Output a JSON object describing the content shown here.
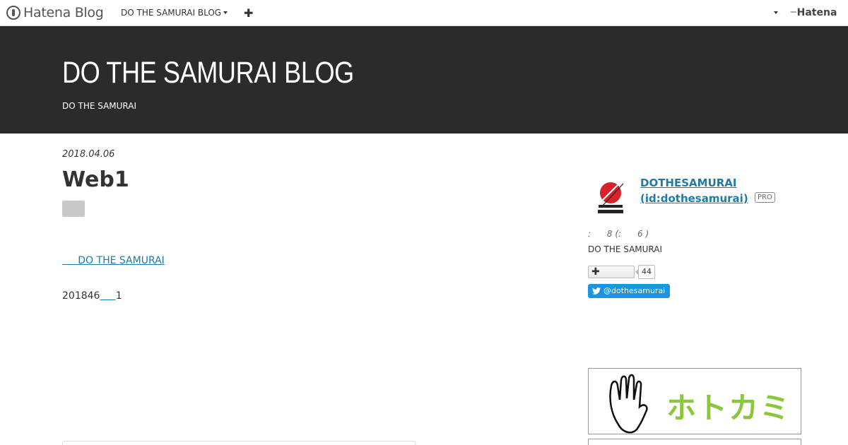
{
  "topbar": {
    "logo_text": "Hatena Blog",
    "blog_menu_label": "DO THE SAMURAI BLOG",
    "plus_label": "✚",
    "hatena_text": "Hatena"
  },
  "header": {
    "title": "DO THE SAMURAI BLOG",
    "description": "DO THE SAMURAI"
  },
  "entry": {
    "date": "2018.04.06",
    "title": "Web1",
    "link_text": "DO THE SAMURAI",
    "link_prefix": "     ",
    "body_prefix": "201846",
    "body_link": "     ",
    "body_suffix": "1"
  },
  "sidebar": {
    "profile_name_line1": "DOTHESAMURAI",
    "profile_name_line2": "(id:dothesamurai)",
    "pro_badge": "PRO",
    "readers_text": ":      8 (:      6 )",
    "profile_desc": "DO THE SAMURAI",
    "follow_plus": "✚",
    "follow_count": "44",
    "twitter_label": "@dothesamurai",
    "ad_text": "ホトカミ"
  },
  "colors": {
    "header_bg": "#2b2b2b",
    "link": "#1f7aa8",
    "twitter": "#1b95e0",
    "ad_green": "#8cc63f"
  }
}
